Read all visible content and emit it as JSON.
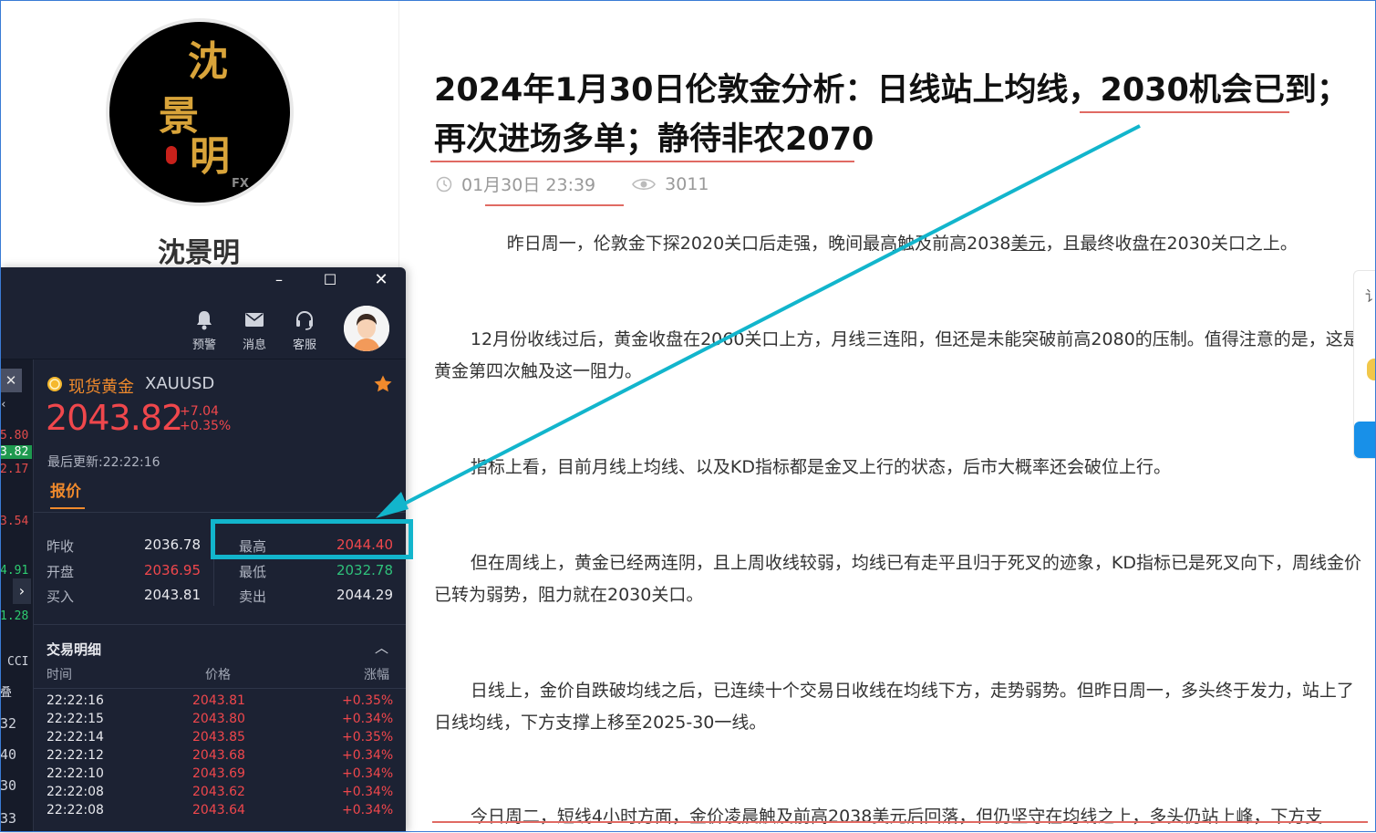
{
  "author": {
    "name": "沈景明",
    "logo_text": [
      "沈",
      "景",
      "明"
    ],
    "logo_mark": "FX"
  },
  "article": {
    "title": "2024年1月30日伦敦金分析：日线站上均线，2030机会已到；再次进场多单；静待非农2070",
    "date": "01月30日 23:39",
    "views": "3011",
    "paragraphs": [
      {
        "before": "昨日周一，伦敦金下探2020关口后走强，晚间最高触及前高2038",
        "link": "美元",
        "after": "，且最终收盘在2030关口之上。"
      },
      {
        "text": "12月份收线过后，黄金收盘在2060关口上方，月线三连阳，但还是未能突破前高2080的压制。值得注意的是，这是黄金第四次触及这一阻力。"
      },
      {
        "text": "指标上看，目前月线上均线、以及KD指标都是金叉上行的状态，后市大概率还会破位上行。"
      },
      {
        "text": "但在周线上，黄金已经两连阴，且上周收线较弱，均线已有走平且归于死叉的迹象，KD指标已是死叉向下，周线金价已转为弱势，阻力就在2030关口。"
      },
      {
        "text": "日线上，金价自跌破均线之后，已连续十个交易日收线在均线下方，走势弱势。但昨日周一，多头终于发力，站上了日线均线，下方支撑上移至2025-30一线。"
      },
      {
        "text": "今日周二，短线4小时方面，金价凌晨触及前高2038美元后回落，但仍坚守在均线之上，多头仍站上峰，下方支"
      }
    ]
  },
  "side_widget": {
    "label": "讠"
  },
  "app": {
    "window_controls": {
      "minimize": "–",
      "maximize": "☐",
      "close": "✕"
    },
    "toolbar": {
      "alert": "预警",
      "messages": "消息",
      "service": "客服"
    },
    "left_strip": {
      "close": "✕",
      "partial_chev": "‹",
      "values": [
        "5.80",
        "3.82",
        "2.17",
        "3.54",
        "4.91",
        "1.28"
      ],
      "label_cci": "CCI",
      "label_die": "叠",
      "numbers": [
        "32",
        "40",
        "30",
        "33"
      ],
      "chevron": "›"
    },
    "symbol": {
      "name": "现货黄金",
      "code": "XAUUSD",
      "price": "2043.82",
      "change_abs": "+7.04",
      "change_pct": "+0.35%",
      "last_update": "最后更新:22:22:16"
    },
    "tab": "报价",
    "quote": {
      "prev_close_label": "昨收",
      "prev_close": "2036.78",
      "open_label": "开盘",
      "open": "2036.95",
      "bid_label": "买入",
      "bid": "2043.81",
      "high_label": "最高",
      "high": "2044.40",
      "low_label": "最低",
      "low": "2032.78",
      "ask_label": "卖出",
      "ask": "2044.29"
    },
    "trades": {
      "title": "交易明细",
      "collapse": "︿",
      "headers": {
        "time": "时间",
        "price": "价格",
        "change": "涨幅"
      },
      "rows": [
        {
          "time": "22:22:16",
          "price": "2043.81",
          "change": "+0.35%"
        },
        {
          "time": "22:22:15",
          "price": "2043.80",
          "change": "+0.34%"
        },
        {
          "time": "22:22:14",
          "price": "2043.85",
          "change": "+0.35%"
        },
        {
          "time": "22:22:12",
          "price": "2043.68",
          "change": "+0.34%"
        },
        {
          "time": "22:22:10",
          "price": "2043.69",
          "change": "+0.34%"
        },
        {
          "time": "22:22:08",
          "price": "2043.62",
          "change": "+0.34%"
        },
        {
          "time": "22:22:08",
          "price": "2043.64",
          "change": "+0.34%"
        }
      ]
    }
  },
  "colors": {
    "accent_red": "#f0474c",
    "accent_orange": "#f08a2c",
    "annotation_cyan": "#12b5cc",
    "underline_red": "#e06a63",
    "app_bg": "#1c2233"
  }
}
